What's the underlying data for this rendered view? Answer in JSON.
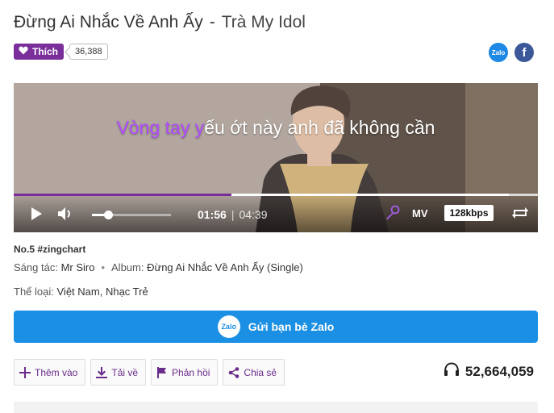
{
  "song": {
    "title": "Đừng Ai Nhắc Về Anh Ấy",
    "separator": "-",
    "artist": "Trà My Idol"
  },
  "like": {
    "label": "Thích",
    "count": "36,388"
  },
  "share_icons": {
    "zalo": "Zalo",
    "facebook": "f"
  },
  "player": {
    "lyric_sung": "Vòng tay y",
    "lyric_rest": "ếu ớt này anh đã không cần",
    "current_time": "01:56",
    "time_divider": "|",
    "total_time": "04:39",
    "progress_fraction": 0.416,
    "buffered_fraction": 0.944,
    "volume_fraction": 0.2,
    "mv_label": "MV",
    "quality_label": "128kbps",
    "accent_color": "#7a2e9a"
  },
  "meta": {
    "rank": "No.5 #zingchart",
    "composer_label": "Sáng tác:",
    "composer": "Mr Siro",
    "album_label": "Album:",
    "album": "Đừng Ai Nhắc Về Anh Ấy (Single)",
    "genre_label": "Thể loại:",
    "genre": "Việt Nam, Nhạc Trẻ"
  },
  "zalo_share": {
    "logo_text": "Zalo",
    "label": "Gửi bạn bè Zalo",
    "color": "#1a8fe3"
  },
  "actions": {
    "add": "Thêm vào",
    "download": "Tải về",
    "feedback": "Phản hồi",
    "share": "Chia sẻ"
  },
  "listen_count": "52,664,059"
}
